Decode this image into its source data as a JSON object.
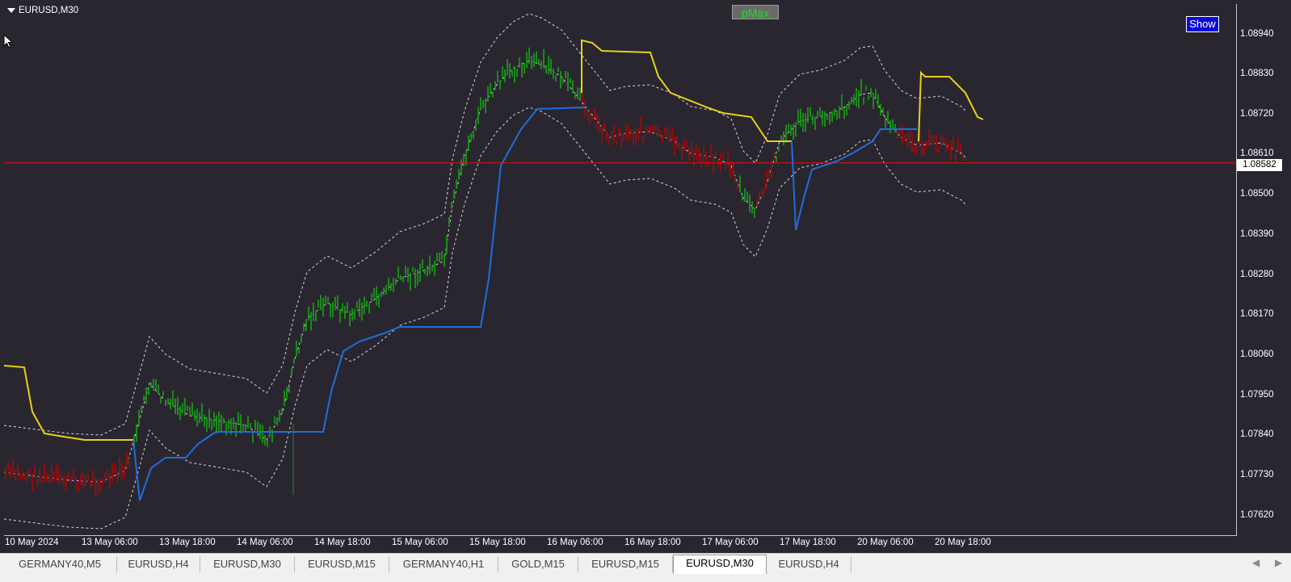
{
  "chart": {
    "symbol": "EURUSD,M30",
    "indicator_button": "pMax",
    "show_button": "Show",
    "current_price": "1.08582",
    "price_labels": [
      "1.08940",
      "1.08830",
      "1.08720",
      "1.08610",
      "1.08500",
      "1.08390",
      "1.08280",
      "1.08170",
      "1.08060",
      "1.07950",
      "1.07840",
      "1.07730",
      "1.07620"
    ],
    "time_labels": [
      "10 May 2024",
      "13 May 06:00",
      "13 May 18:00",
      "14 May 06:00",
      "14 May 18:00",
      "15 May 06:00",
      "15 May 18:00",
      "16 May 06:00",
      "16 May 18:00",
      "17 May 06:00",
      "17 May 18:00",
      "20 May 06:00",
      "20 May 18:00"
    ]
  },
  "tabs": [
    {
      "label": "GERMANY40,M5"
    },
    {
      "label": "EURUSD,H4"
    },
    {
      "label": "EURUSD,M30"
    },
    {
      "label": "EURUSD,M15"
    },
    {
      "label": "GERMANY40,H1"
    },
    {
      "label": "GOLD,M15"
    },
    {
      "label": "EURUSD,M15"
    },
    {
      "label": "EURUSD,M30"
    },
    {
      "label": "EURUSD,H4"
    }
  ],
  "active_tab_index": 7,
  "colors": {
    "background": "#2a2630",
    "bull_candle": "#1a8a1a",
    "bear_candle": "#8a1010",
    "pmax_support": "#1e6fd9",
    "pmax_resistance": "#e6d21a",
    "price_line": "#e01010",
    "envelope": "#d9d9d9"
  },
  "chart_data": {
    "type": "line",
    "x": [
      "10 May 2024",
      "13 May 06:00",
      "13 May 18:00",
      "14 May 06:00",
      "14 May 18:00",
      "15 May 06:00",
      "15 May 18:00",
      "16 May 06:00",
      "16 May 18:00",
      "17 May 06:00",
      "17 May 18:00",
      "20 May 06:00",
      "20 May 18:00"
    ],
    "series": [
      {
        "values": [
          1.0771,
          1.077,
          1.0796,
          1.0785,
          1.0813,
          1.0828,
          1.0891,
          1.0872,
          1.0862,
          1.0845,
          1.0868,
          1.088,
          1.086
        ]
      }
    ],
    "ylim": [
      1.076,
      1.09
    ],
    "grid": false,
    "current_price": 1.08582
  }
}
